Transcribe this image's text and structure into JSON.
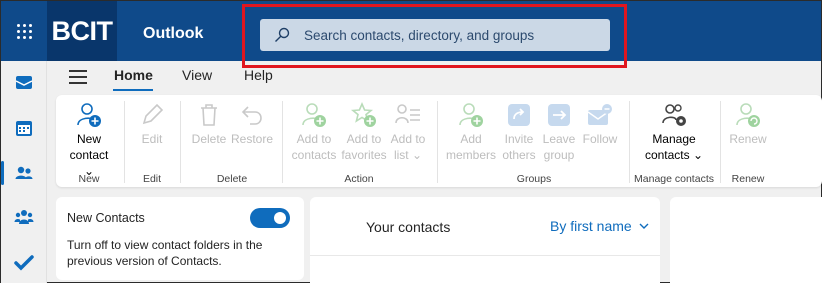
{
  "header": {
    "logo": "BCIT",
    "app_name": "Outlook",
    "search_placeholder": "Search contacts, directory, and groups"
  },
  "tabs": [
    {
      "label": "Home",
      "active": true
    },
    {
      "label": "View"
    },
    {
      "label": "Help"
    }
  ],
  "ribbon": {
    "new_contact": {
      "line1": "New",
      "line2": "contact"
    },
    "edit": "Edit",
    "delete": "Delete",
    "restore": "Restore",
    "add_to_contacts": {
      "line1": "Add to",
      "line2": "contacts"
    },
    "add_to_favorites": {
      "line1": "Add to",
      "line2": "favorites"
    },
    "add_to_list": {
      "line1": "Add to",
      "line2": "list"
    },
    "add_members": {
      "line1": "Add",
      "line2": "members"
    },
    "invite_others": {
      "line1": "Invite",
      "line2": "others"
    },
    "leave_group": {
      "line1": "Leave",
      "line2": "group"
    },
    "follow": "Follow",
    "manage_contacts": {
      "line1": "Manage",
      "line2": "contacts"
    },
    "renew": "Renew",
    "groups": {
      "new": "New",
      "edit": "Edit",
      "delete": "Delete",
      "action": "Action",
      "groups": "Groups",
      "manage_contacts": "Manage contacts",
      "renew": "Renew"
    }
  },
  "new_contacts_panel": {
    "title": "New Contacts",
    "toggle_on": true,
    "description": "Turn off to view contact folders in the previous version of Contacts."
  },
  "contacts_list": {
    "title": "Your contacts",
    "sort_label": "By first name"
  },
  "colors": {
    "topbar": "#0f4a8a",
    "logo_bg": "#09366b",
    "accent": "#0f6cbd",
    "highlight": "#e0161f",
    "green_icon": "#6fbf73"
  }
}
